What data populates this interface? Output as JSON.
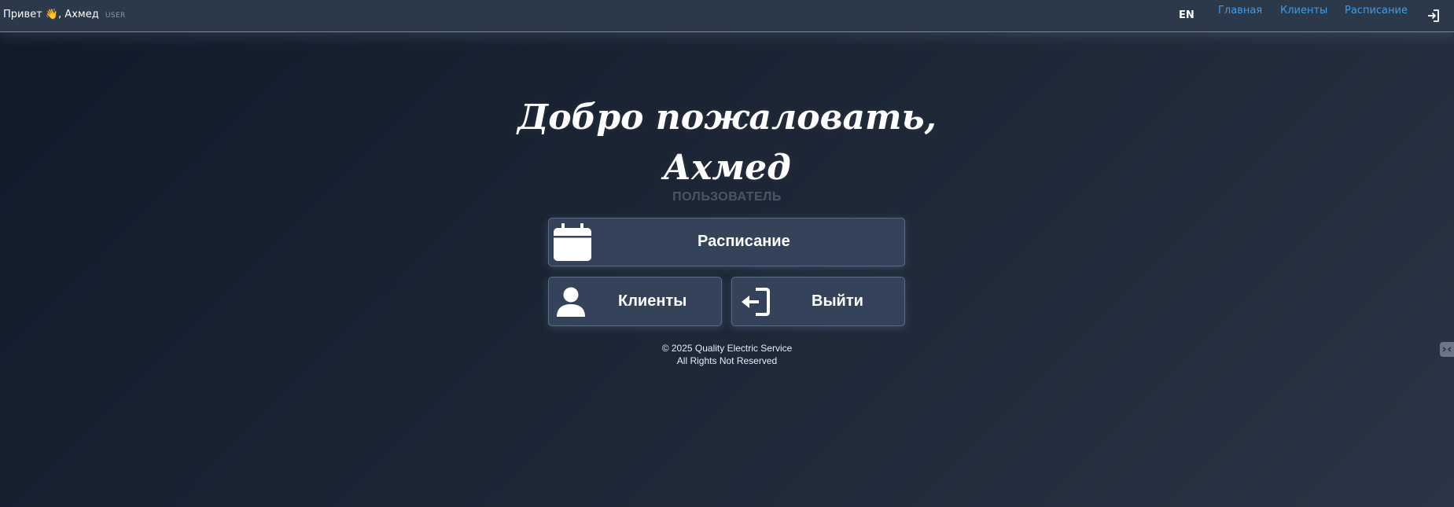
{
  "header": {
    "greeting": "Привет",
    "greeting_emoji": "👋",
    "user_name": ", Ахмед",
    "role_tag": "USER",
    "language": "EN",
    "nav": {
      "home": "Главная",
      "clients": "Клиенты",
      "schedule": "Расписание"
    }
  },
  "welcome": {
    "line1": "Добро пожаловать,",
    "line2": "Ахмед",
    "role": "ПОЛЬЗОВАТЕЛЬ"
  },
  "cards": {
    "schedule": "Расписание",
    "clients": "Клиенты",
    "logout": "Выйти"
  },
  "footer": {
    "line1": "© 2025 Quality Electric Service",
    "line2": "All Rights Not Reserved"
  },
  "colors": {
    "nav_link": "#3f9dea",
    "topbar": "#2c394b",
    "card": "#35435a"
  },
  "icons": {
    "logout_top": "logout-icon",
    "schedule": "calendar-icon",
    "clients": "user-icon",
    "logout_card": "logout-icon",
    "side_widget": "widget-icon"
  }
}
